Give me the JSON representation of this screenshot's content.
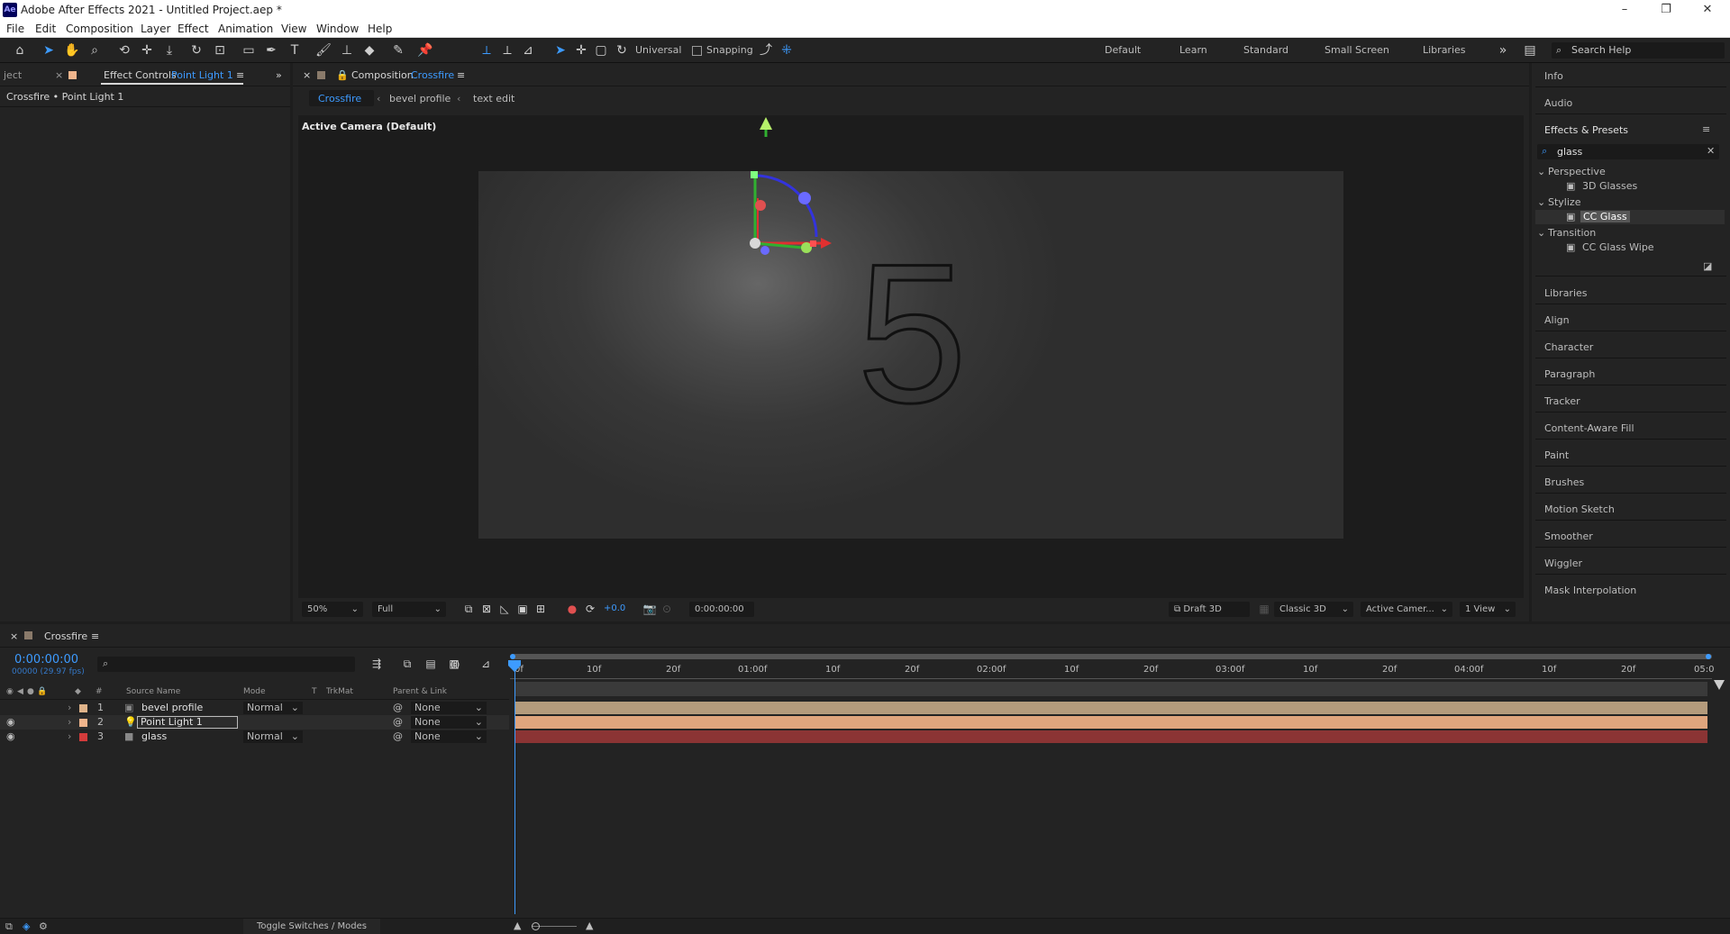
{
  "app": {
    "title": "Adobe After Effects 2021 - Untitled Project.aep *",
    "icon_text": "Ae"
  },
  "window_controls": {
    "minimize": "–",
    "restore": "❐",
    "close": "✕"
  },
  "menu": [
    "File",
    "Edit",
    "Composition",
    "Layer",
    "Effect",
    "Animation",
    "View",
    "Window",
    "Help"
  ],
  "toolbar": {
    "axis_mode": "Universal",
    "snapping_label": "Snapping",
    "workspaces": [
      "Default",
      "Learn",
      "Standard",
      "Small Screen",
      "Libraries"
    ],
    "search_help": "Search Help"
  },
  "project_panel": {
    "tab": "ject"
  },
  "effect_controls": {
    "tab_prefix": "Effect Controls",
    "tab_layer": "Point Light 1",
    "subtitle": "Crossfire • Point Light 1"
  },
  "composition": {
    "tab_prefix": "Composition",
    "tab_name": "Crossfire",
    "breadcrumbs": [
      "Crossfire",
      "bevel profile",
      "text edit"
    ],
    "camera_label": "Active Camera (Default)",
    "canvas_text": "5",
    "footer": {
      "zoom": "50%",
      "resolution": "Full",
      "exposure": "+0.0",
      "timecode": "0:00:00:00",
      "draft": "Draft 3D",
      "renderer": "Classic 3D",
      "camera": "Active Camer...",
      "views": "1 View"
    }
  },
  "right_panel": {
    "top_items": [
      "Info",
      "Audio"
    ],
    "effects_title": "Effects & Presets",
    "search_value": "glass",
    "tree": [
      {
        "category": "Perspective",
        "effect": "3D Glasses"
      },
      {
        "category": "Stylize",
        "effect": "CC Glass",
        "selected": true
      },
      {
        "category": "Transition",
        "effect": "CC Glass Wipe"
      }
    ],
    "bottom_items": [
      "Libraries",
      "Align",
      "Character",
      "Paragraph",
      "Tracker",
      "Content-Aware Fill",
      "Paint",
      "Brushes",
      "Motion Sketch",
      "Smoother",
      "Wiggler",
      "Mask Interpolation"
    ]
  },
  "timeline": {
    "tab": "Crossfire",
    "timecode": "0:00:00:00",
    "fps": "00000 (29.97 fps)",
    "columns": {
      "num": "#",
      "source": "Source Name",
      "mode": "Mode",
      "t": "T",
      "trkmat": "TrkMat",
      "parent": "Parent & Link"
    },
    "layers": [
      {
        "num": "1",
        "name": "bevel profile",
        "mode": "Normal",
        "parent": "None",
        "label_color": "#e0b48a",
        "bar_color": "#b49b7c"
      },
      {
        "num": "2",
        "name": "Point Light 1",
        "mode": "",
        "parent": "None",
        "label_color": "#f0b58c",
        "bar_color": "#e0a57d"
      },
      {
        "num": "3",
        "name": "glass",
        "mode": "Normal",
        "parent": "None",
        "label_color": "#d33b3b",
        "bar_color": "#8b3434"
      }
    ],
    "ruler": [
      "0f",
      "10f",
      "20f",
      "01:00f",
      "10f",
      "20f",
      "02:00f",
      "10f",
      "20f",
      "03:00f",
      "10f",
      "20f",
      "04:00f",
      "10f",
      "20f",
      "05:0"
    ],
    "footer_toggle": "Toggle Switches / Modes"
  },
  "colors": {
    "accent": "#3d9bff",
    "panel_bg": "#232323",
    "app_bg": "#1d1d1d"
  }
}
